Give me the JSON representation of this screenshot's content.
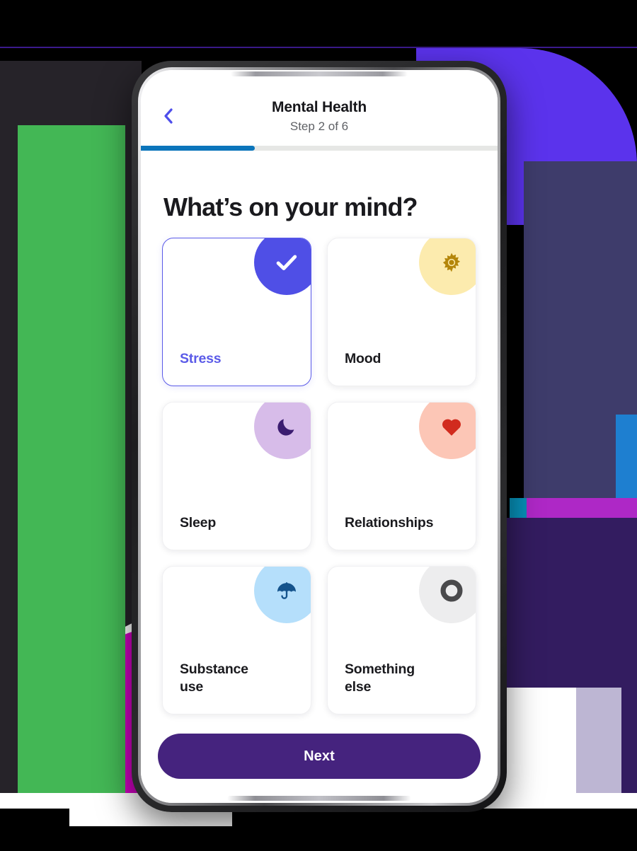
{
  "app": {
    "header": {
      "back_icon": "chevron-left-icon",
      "title": "Mental Health",
      "step_label": "Step 2 of 6",
      "progress_percent": 32,
      "progress_fill_color": "#0B75BB",
      "progress_track_color": "#E6E7E5",
      "back_icon_color": "#4E4EEB"
    },
    "heading": "What’s on your mind?",
    "cards": [
      {
        "label": "Stress",
        "selected": true,
        "icon": "check-icon",
        "bubble_color": "#4F4FE6",
        "icon_color": "#FFFFFF",
        "label_color": "#5B5BE8"
      },
      {
        "label": "Mood",
        "selected": false,
        "icon": "sun-icon",
        "bubble_color": "#FCEBAE",
        "icon_color": "#B4860B",
        "label_color": "#1A1A1E"
      },
      {
        "label": "Sleep",
        "selected": false,
        "icon": "moon-icon",
        "bubble_color": "#D7BCE9",
        "icon_color": "#3B1C70",
        "label_color": "#1A1A1E"
      },
      {
        "label": "Relationships",
        "selected": false,
        "icon": "heart-icon",
        "bubble_color": "#FCC6B6",
        "icon_color": "#D12B1E",
        "label_color": "#1A1A1E"
      },
      {
        "label": "Substance\nuse",
        "selected": false,
        "icon": "umbrella-icon",
        "bubble_color": "#B5DFFB",
        "icon_color": "#14538C",
        "label_color": "#1A1A1E"
      },
      {
        "label": "Something\nelse",
        "selected": false,
        "icon": "ring-icon",
        "bubble_color": "#EDEDEE",
        "icon_color": "#4A4A4C",
        "label_color": "#1A1A1E"
      }
    ],
    "footer": {
      "next_label": "Next",
      "next_bg_color": "#45237E",
      "next_text_color": "#FFFFFF"
    }
  },
  "background": {
    "page_color": "#000000",
    "shapes": [
      {
        "name": "purple-quarter-arc",
        "color": "#5B33EC"
      },
      {
        "name": "indigo-block",
        "color": "#3E3C6B"
      },
      {
        "name": "dark-panel",
        "color": "#262329"
      },
      {
        "name": "green-rectangle",
        "color": "#43B755"
      },
      {
        "name": "magenta-circle",
        "color": "#CF00C0"
      },
      {
        "name": "white-rounded-shape",
        "color": "#FFFFFF"
      },
      {
        "name": "cyan-semicircle",
        "color": "#00AEDC"
      },
      {
        "name": "blue-strip",
        "color": "#1E7FD0"
      },
      {
        "name": "magenta-strip",
        "color": "#AE28C6"
      },
      {
        "name": "deep-purple-block",
        "color": "#331C60"
      },
      {
        "name": "lavender-strip",
        "color": "#BDB6D3"
      }
    ]
  }
}
